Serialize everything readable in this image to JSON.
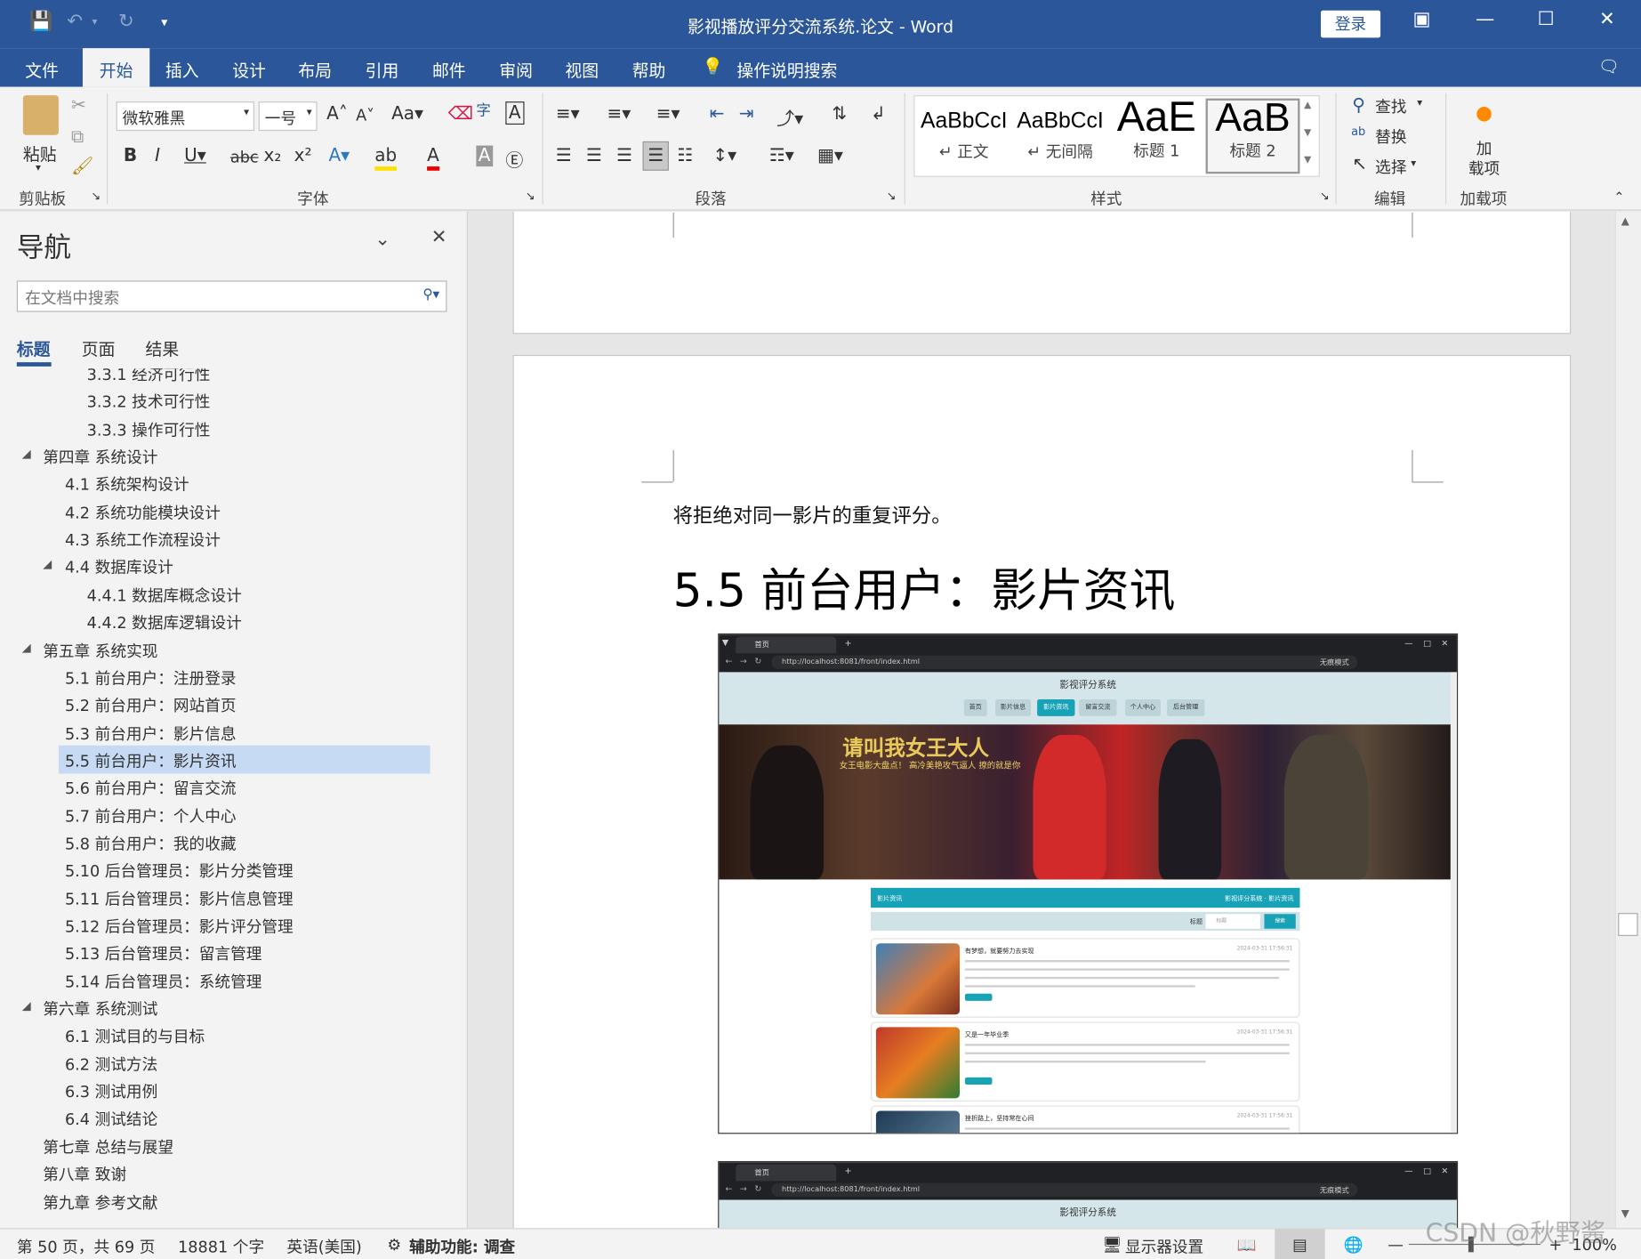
{
  "window": {
    "title": "影视播放评分交流系统.论文 - Word",
    "login_label": "登录"
  },
  "menu_tabs": [
    "文件",
    "开始",
    "插入",
    "设计",
    "布局",
    "引用",
    "邮件",
    "审阅",
    "视图",
    "帮助"
  ],
  "tell_me": "操作说明搜索",
  "ribbon": {
    "paste_label": "粘贴",
    "font_name": "微软雅黑",
    "font_size": "一号",
    "groups": [
      "剪贴板",
      "字体",
      "段落",
      "样式",
      "编辑",
      "加载项"
    ],
    "styles": [
      {
        "preview": "AaBbCcI",
        "name": "↵ 正文"
      },
      {
        "preview": "AaBbCcI",
        "name": "↵ 无间隔"
      },
      {
        "preview": "AaE",
        "name": "标题 1"
      },
      {
        "preview": "AaB",
        "name": "标题 2"
      }
    ],
    "edit": {
      "find": "查找",
      "replace": "替换",
      "select": "选择"
    },
    "addin_label": "加\n载项"
  },
  "nav": {
    "title": "导航",
    "search_placeholder": "在文档中搜索",
    "tabs": [
      "标题",
      "页面",
      "结果"
    ],
    "items": [
      {
        "label": "3.3.1 经济可行性",
        "level": 3
      },
      {
        "label": "3.3.2 技术可行性",
        "level": 3
      },
      {
        "label": "3.3.3 操作可行性",
        "level": 3
      },
      {
        "label": "第四章 系统设计",
        "level": 1
      },
      {
        "label": "4.1 系统架构设计",
        "level": 2
      },
      {
        "label": "4.2 系统功能模块设计",
        "level": 2
      },
      {
        "label": "4.3 系统工作流程设计",
        "level": 2
      },
      {
        "label": "4.4 数据库设计",
        "level": 2
      },
      {
        "label": "4.4.1 数据库概念设计",
        "level": 3
      },
      {
        "label": "4.4.2 数据库逻辑设计",
        "level": 3
      },
      {
        "label": "第五章 系统实现",
        "level": 1
      },
      {
        "label": "5.1 前台用户：注册登录",
        "level": 2
      },
      {
        "label": "5.2 前台用户：网站首页",
        "level": 2
      },
      {
        "label": "5.3 前台用户：影片信息",
        "level": 2
      },
      {
        "label": "5.5 前台用户：影片资讯",
        "level": 2
      },
      {
        "label": "5.6 前台用户：留言交流",
        "level": 2
      },
      {
        "label": "5.7 前台用户：个人中心",
        "level": 2
      },
      {
        "label": "5.8 前台用户：我的收藏",
        "level": 2
      },
      {
        "label": "5.10 后台管理员：影片分类管理",
        "level": 2
      },
      {
        "label": "5.11 后台管理员：影片信息管理",
        "level": 2
      },
      {
        "label": "5.12 后台管理员：影片评分管理",
        "level": 2
      },
      {
        "label": "5.13 后台管理员：留言管理",
        "level": 2
      },
      {
        "label": "5.14 后台管理员：系统管理",
        "level": 2
      },
      {
        "label": "第六章 系统测试",
        "level": 1
      },
      {
        "label": "6.1 测试目的与目标",
        "level": 2
      },
      {
        "label": "6.2 测试方法",
        "level": 2
      },
      {
        "label": "6.3 测试用例",
        "level": 2
      },
      {
        "label": "6.4 测试结论",
        "level": 2
      },
      {
        "label": "第七章 总结与展望",
        "level": 1
      },
      {
        "label": "第八章 致谢",
        "level": 1
      },
      {
        "label": "第九章 参考文献",
        "level": 1
      }
    ]
  },
  "document": {
    "paragraph": "将拒绝对同一影片的重复评分。",
    "heading": "5.5  前台用户：影片资讯",
    "screenshot": {
      "tab_title": "首页",
      "url": "http://localhost:8081/front/index.html",
      "incognito": "无痕模式",
      "site_title": "影视评分系统",
      "site_nav": [
        "首页",
        "影片信息",
        "影片资讯",
        "留言交流",
        "个人中心",
        "后台管理"
      ],
      "banner_title": "请叫我女王大人",
      "banner_subtitle": "女王电影大盘点！ 高冷美艳攻气逼人 撩的就是你",
      "news_header": "影片资讯",
      "news_breadcrumb": "影视评分系统 · 影片资讯",
      "filter_label": "标题",
      "filter_placeholder": "标题",
      "search_button": "搜索",
      "articles": [
        {
          "title": "有梦想，就要努力去实现",
          "date": "2024-03-31 17:56:31"
        },
        {
          "title": "又是一年毕业季",
          "date": "2024-03-31 17:56:31"
        },
        {
          "title": "挫折路上，坚持常在心间",
          "date": "2024-03-31 17:56:31"
        }
      ]
    }
  },
  "status": {
    "page": "第 50 页，共 69 页",
    "words": "18881 个字",
    "language": "英语(美国)",
    "accessibility": "辅助功能: 调查",
    "display": "显示器设置",
    "zoom": "100%"
  },
  "watermark": "CSDN @秋野酱",
  "colors": {
    "accent": "#2b579a",
    "nav_highlight": "#c7daf3",
    "site_accent": "#17a2b8"
  }
}
